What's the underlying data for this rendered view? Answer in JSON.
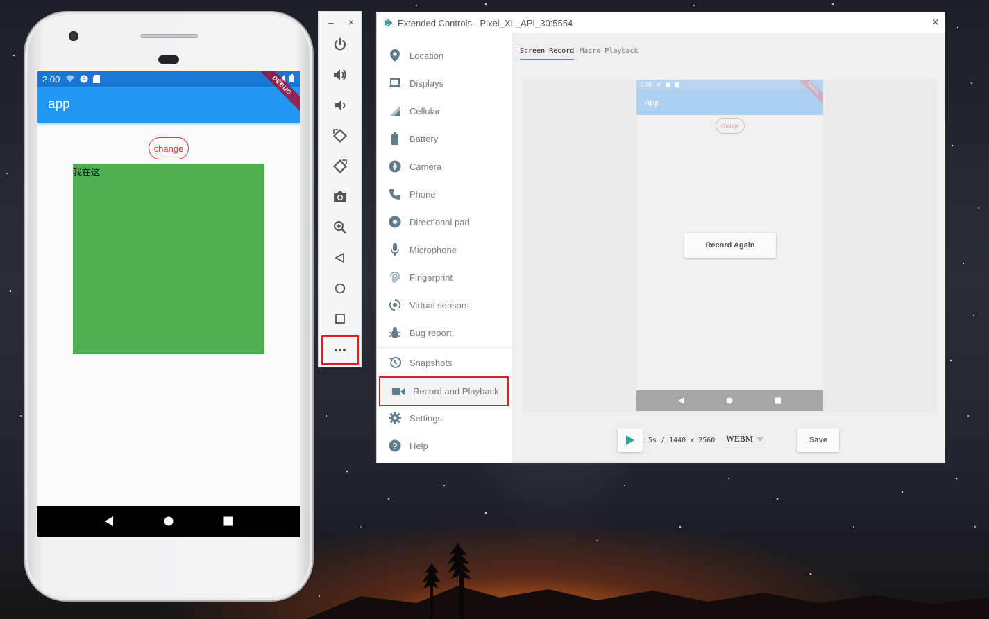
{
  "phone": {
    "status_time": "2:00",
    "app_title": "app",
    "debug_label": "DEBUG",
    "change_label": "change",
    "box_text": "我在这"
  },
  "toolbar": {
    "minimize_label": "–",
    "close_label": "×",
    "buttons": [
      "power-icon",
      "volume-up-icon",
      "volume-down-icon",
      "rotate-left-icon",
      "rotate-right-icon",
      "camera-icon",
      "zoom-icon",
      "back-icon",
      "home-icon",
      "overview-icon",
      "more-icon"
    ]
  },
  "extended": {
    "title": "Extended Controls - Pixel_XL_API_30:5554",
    "close_label": "×",
    "nav": [
      {
        "label": "Location",
        "icon": "location-pin-icon"
      },
      {
        "label": "Displays",
        "icon": "laptop-icon"
      },
      {
        "label": "Cellular",
        "icon": "signal-icon"
      },
      {
        "label": "Battery",
        "icon": "battery-icon"
      },
      {
        "label": "Camera",
        "icon": "aperture-icon"
      },
      {
        "label": "Phone",
        "icon": "phone-icon"
      },
      {
        "label": "Directional pad",
        "icon": "dpad-icon"
      },
      {
        "label": "Microphone",
        "icon": "microphone-icon"
      },
      {
        "label": "Fingerprint",
        "icon": "fingerprint-icon"
      },
      {
        "label": "Virtual sensors",
        "icon": "sensor-icon"
      },
      {
        "label": "Bug report",
        "icon": "bug-icon"
      },
      {
        "label": "Snapshots",
        "icon": "history-icon"
      },
      {
        "label": "Record and Playback",
        "icon": "videocam-icon"
      },
      {
        "label": "Settings",
        "icon": "gear-icon"
      },
      {
        "label": "Help",
        "icon": "help-icon"
      }
    ],
    "tabs": [
      "Screen Record",
      "Macro Playback"
    ],
    "active_tab": "Screen Record",
    "preview": {
      "status_time": "1:38",
      "app_title": "app",
      "debug_label": "DEBUG",
      "change_label": "change",
      "record_again_label": "Record Again"
    },
    "recording_info": "5s / 1440 x 2560",
    "format": "WEBM",
    "save_label": "Save"
  },
  "colors": {
    "accent_teal": "#26a69a",
    "highlight_red": "#e02020",
    "flutter_blue": "#2196f3",
    "green_box": "#4caf50"
  }
}
